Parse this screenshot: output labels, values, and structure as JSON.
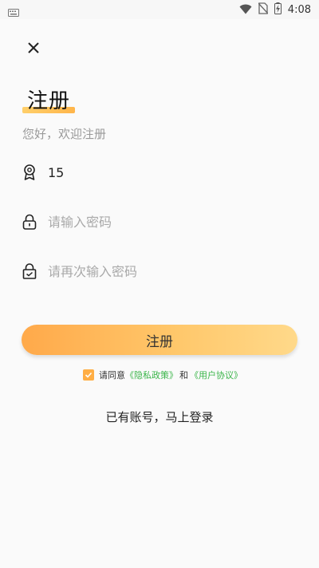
{
  "status_bar": {
    "time": "4:08",
    "icons": [
      "keyboard-icon",
      "wifi-icon",
      "no-sim-icon",
      "battery-charging-icon"
    ]
  },
  "header": {
    "close_icon": "close-icon",
    "title": "注册",
    "subtitle": "您好，欢迎注册",
    "accent_color": "#ffb54a"
  },
  "form": {
    "account": {
      "icon": "user-badge-icon",
      "value": "15",
      "placeholder": ""
    },
    "password": {
      "icon": "lock-icon",
      "value": "",
      "placeholder": "请输入密码"
    },
    "confirm_password": {
      "icon": "lock-check-icon",
      "value": "",
      "placeholder": "请再次输入密码"
    },
    "submit_label": "注册"
  },
  "agreement": {
    "checked": true,
    "prefix": "请同意",
    "privacy_link": "《隐私政策》",
    "and": "和",
    "user_link": "《用户协议》",
    "link_color": "#3bb54a",
    "checkbox_color": "#ffae45"
  },
  "login_link": "已有账号，马上登录"
}
